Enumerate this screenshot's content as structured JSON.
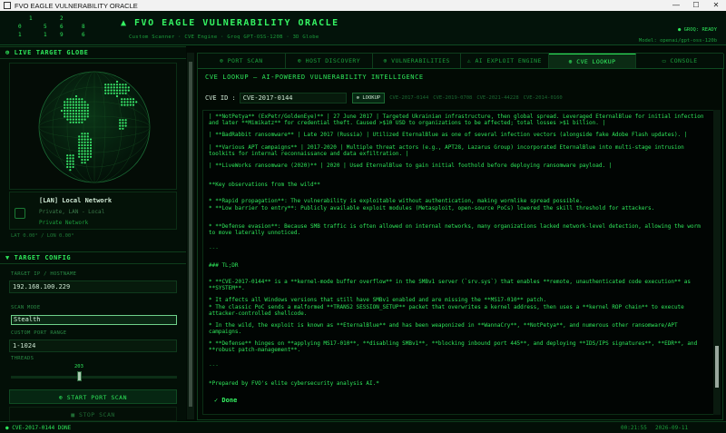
{
  "window": {
    "title": "FVO EAGLE VULNERABILITY ORACLE"
  },
  "header": {
    "matrix_digits": [
      "1",
      "2",
      "0",
      "5",
      "6",
      "8",
      "1",
      "1",
      "9",
      "6"
    ],
    "title": "▲ FVO  EAGLE  VULNERABILITY  ORACLE",
    "subtitle": "Custom Scanner · CVE Engine · Groq GPT-OSS-120B · 3D Globe",
    "status": "● GROQ: READY",
    "model": "Model: openai/gpt-oss-120b"
  },
  "globe": {
    "title": "⊕ LIVE TARGET GLOBE"
  },
  "network": {
    "title": "[LAN] Local Network",
    "subtitle": "Private, LAN - Local",
    "type": "Private Network",
    "coords": "LAT 0.00°  /  LON 0.00°"
  },
  "config": {
    "title": "▼ TARGET CONFIG",
    "target_label": "TARGET IP / HOSTNAME",
    "target_value": "192.168.100.229",
    "scan_mode_label": "SCAN MODE",
    "scan_mode_value": "Stealth",
    "port_range_label": "CUSTOM PORT RANGE",
    "port_range_value": "1-1024",
    "threads_label": "THREADS",
    "threads_value": "203",
    "threads_fraction": 0.41,
    "start_button": "⊕ START PORT SCAN",
    "stop_button": "■ STOP SCAN"
  },
  "tabs": [
    {
      "label": "⊕ PORT SCAN",
      "active": false
    },
    {
      "label": "⊕ HOST DISCOVERY",
      "active": false
    },
    {
      "label": "⊕ VULNERABILITIES",
      "active": false
    },
    {
      "label": "⚠ AI EXPLOIT ENGINE",
      "active": false
    },
    {
      "label": "⊕ CVE LOOKUP",
      "active": true
    },
    {
      "label": "▭ CONSOLE",
      "active": false
    }
  ],
  "cve": {
    "heading": "CVE LOOKUP — AI-POWERED VULNERABILITY INTELLIGENCE",
    "id_label": "CVE ID :",
    "id_value": "CVE-2017-0144",
    "lookup_button": "⊕ LOOKUP",
    "recent": [
      "CVE-2017-0144",
      "CVE-2019-0708",
      "CVE-2021-44228",
      "CVE-2014-0160"
    ],
    "output_lines": [
      "| **NotPetya** (ExPetr/GoldenEye)** | 27 June 2017 | Targeted Ukrainian infrastructure, then global spread. Leveraged EternalBlue for initial infection and later **Mimikatz** for credential theft. Caused >$10 USD to organizations to be affected; total losses >$1 billion. |",
      "| **BadRabbit ransomware** | Late 2017 (Russia) | Utilized EternalBlue as one of several infection vectors (alongside fake Adobe Flash updates). |",
      "| **Various APT campaigns** | 2017-2020 | Multiple threat actors (e.g., APT28, Lazarus Group) incorporated EternalBlue into multi-stage intrusion toolkits for internal reconnaissance and data exfiltration. |",
      "| **LiveWorks ransomware (2020)** | 2020 | Used EternalBlue to gain initial foothold before deploying ransomware payload. |",
      "**Key observations from the wild**",
      "* **Rapid propagation**: The vulnerability is exploitable without authentication, making wormlike spread possible.",
      "* **Low barrier to entry**: Publicly available exploit modules (Metasploit, open-source PoCs) lowered the skill threshold for attackers.",
      "* **Defense evasion**: Because SMB traffic is often allowed on internal networks, many organizations lacked network-level detection, allowing the worm to move laterally unnoticed.",
      "---",
      "### TL;DR",
      "* **CVE-2017-0144** is a **kernel-mode buffer overflow** in the SMBv1 server (`srv.sys`) that enables **remote, unauthenticated code execution** as **SYSTEM**.",
      "* It affects all Windows versions that still have SMBv1 enabled and are missing the **MS17-010** patch.",
      "* The classic PoC sends a malformed **TRANS2 SESSION_SETUP** packet that overwrites a kernel address, then uses a **kernel ROP chain** to execute attacker-controlled shellcode.",
      "* In the wild, the exploit is known as **EternalBlue** and has been weaponized in **WannaCry**, **NotPetya**, and numerous other ransomware/APT campaigns.",
      "* **Defense** hinges on **applying MS17-010**, **disabling SMBv1**, **blocking inbound port 445**, and deploying **IDS/IPS signatures**, **EDR**, and **robust patch-management**.",
      "---",
      "*Prepared by FVO's elite cybersecurity analysis AI.*"
    ],
    "done": "✓ Done"
  },
  "statusbar": {
    "left": "● CVE-2017-0144 DONE",
    "time": "00:21:55",
    "date": "2026-09-11"
  },
  "colors": {
    "accent": "#2ee65a",
    "background": "#020a04",
    "panel": "#030f07"
  }
}
